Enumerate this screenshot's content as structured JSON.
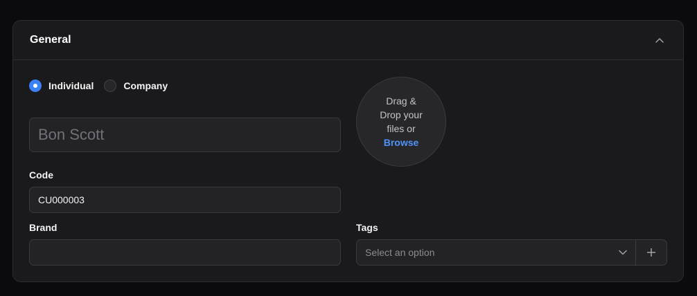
{
  "section": {
    "title": "General"
  },
  "entity_type": {
    "options": [
      {
        "label": "Individual",
        "checked": true
      },
      {
        "label": "Company",
        "checked": false
      }
    ]
  },
  "name_field": {
    "placeholder": "Bon Scott",
    "value": ""
  },
  "code_field": {
    "label": "Code",
    "value": "CU000003"
  },
  "upload": {
    "line1": "Drag &",
    "line2": "Drop your",
    "line3": "files or",
    "browse": "Browse"
  },
  "brand_field": {
    "label": "Brand",
    "value": ""
  },
  "tags_field": {
    "label": "Tags",
    "placeholder": "Select an option"
  },
  "colors": {
    "accent": "#3b82f6",
    "link": "#4f93f7",
    "panel_bg": "#1a1a1d",
    "page_bg": "#0b0b0d"
  },
  "icons": {
    "collapse": "chevron-up-icon",
    "dropdown": "chevron-down-icon",
    "add": "plus-icon"
  }
}
